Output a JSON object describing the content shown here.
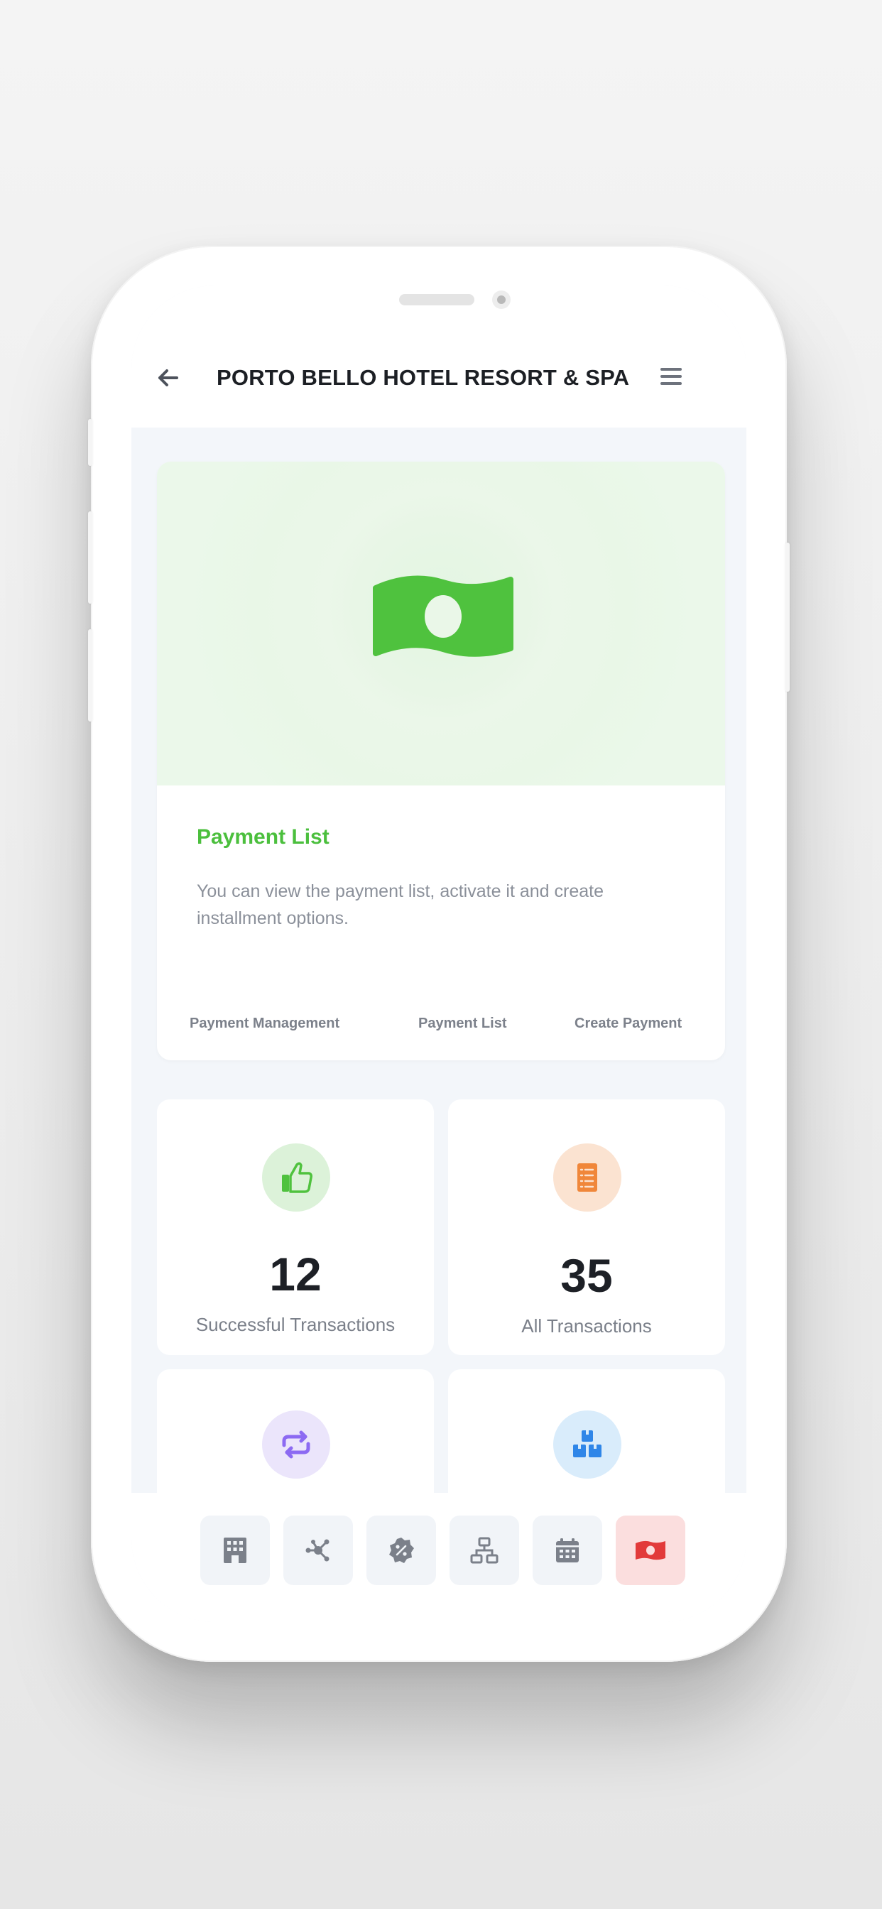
{
  "header": {
    "title": "PORTO BELLO HOTEL RESORT & SPA",
    "back_icon": "arrow-left-icon",
    "menu_icon": "hamburger-menu-icon"
  },
  "payment_card": {
    "hero_icon": "money-bill-icon",
    "title": "Payment List",
    "description": "You can view the payment list, activate it and create installment options.",
    "links": [
      "Payment Management",
      "Payment List",
      "Create Payment"
    ],
    "accent_color": "#4bbf3d"
  },
  "stats": [
    {
      "value": "12",
      "label": "Successful Transactions",
      "icon": "thumbs-up-icon",
      "color": "#4bbf3d"
    },
    {
      "value": "35",
      "label": "All Transactions",
      "icon": "checklist-icon",
      "color": "#f0873a"
    },
    {
      "value": "",
      "label": "",
      "icon": "repeat-icon",
      "color": "#8c6af2"
    },
    {
      "value": "",
      "label": "",
      "icon": "boxes-icon",
      "color": "#2f86e8"
    }
  ],
  "tabbar": {
    "items": [
      {
        "icon": "hotel-icon",
        "active": false
      },
      {
        "icon": "network-icon",
        "active": false
      },
      {
        "icon": "discount-badge-icon",
        "active": false
      },
      {
        "icon": "sitemap-icon",
        "active": false
      },
      {
        "icon": "calendar-icon",
        "active": false
      },
      {
        "icon": "money-bill-icon",
        "active": true
      }
    ],
    "active_color": "#e23a3a"
  }
}
